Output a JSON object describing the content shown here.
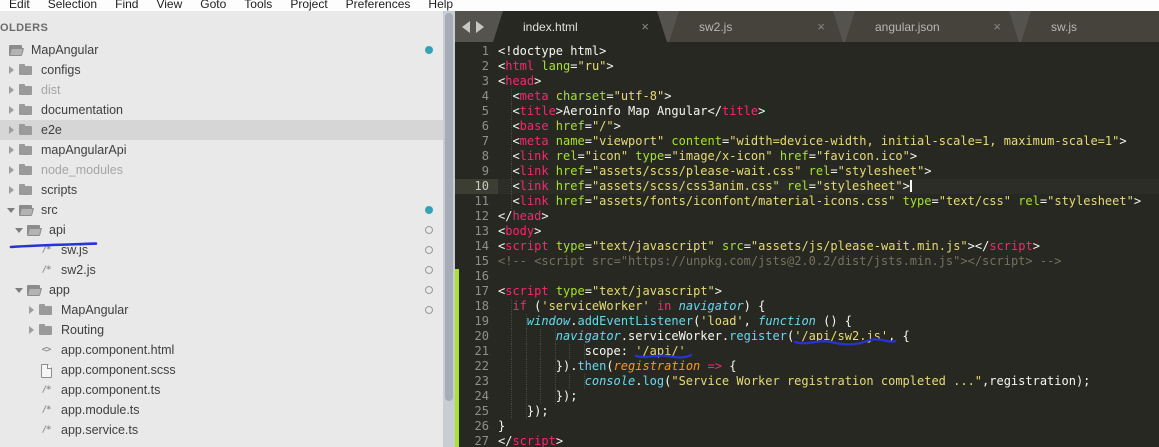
{
  "menu": {
    "items": [
      {
        "label": "Edit",
        "u": 0
      },
      {
        "label": "Selection",
        "u": 0
      },
      {
        "label": "Find",
        "u": 0
      },
      {
        "label": "View",
        "u": 0
      },
      {
        "label": "Goto",
        "u": 0
      },
      {
        "label": "Tools",
        "u": 0
      },
      {
        "label": "Project",
        "u": 0
      },
      {
        "label": "Preferences",
        "u": 7
      },
      {
        "label": "Help",
        "u": 0
      }
    ]
  },
  "sidebar": {
    "header": "OLDERS",
    "tree": [
      {
        "label": "MapAngular",
        "depth": 0,
        "icon": "folder-open",
        "arrow": null,
        "badge": "filled"
      },
      {
        "label": "configs",
        "depth": 1,
        "icon": "folder",
        "arrow": "right"
      },
      {
        "label": "dist",
        "depth": 1,
        "icon": "folder",
        "arrow": "right",
        "dim": true
      },
      {
        "label": "documentation",
        "depth": 1,
        "icon": "folder",
        "arrow": "right"
      },
      {
        "label": "e2e",
        "depth": 1,
        "icon": "folder",
        "arrow": "right",
        "selected": true
      },
      {
        "label": "mapAngularApi",
        "depth": 1,
        "icon": "folder",
        "arrow": "right"
      },
      {
        "label": "node_modules",
        "depth": 1,
        "icon": "folder",
        "arrow": "right",
        "dim": true
      },
      {
        "label": "scripts",
        "depth": 1,
        "icon": "folder",
        "arrow": "right"
      },
      {
        "label": "src",
        "depth": 1,
        "icon": "folder-open",
        "arrow": "down",
        "badge": "filled"
      },
      {
        "label": "api",
        "depth": 2,
        "icon": "folder-open",
        "arrow": "down",
        "badge": "hollow"
      },
      {
        "label": "sw.js",
        "depth": 3,
        "icon": "js",
        "badge": "hollow"
      },
      {
        "label": "sw2.js",
        "depth": 3,
        "icon": "js",
        "badge": "hollow"
      },
      {
        "label": "app",
        "depth": 2,
        "icon": "folder-open",
        "arrow": "down",
        "badge": "hollow"
      },
      {
        "label": "MapAngular",
        "depth": 3,
        "icon": "folder",
        "arrow": "right",
        "badge": "hollow"
      },
      {
        "label": "Routing",
        "depth": 3,
        "icon": "folder",
        "arrow": "right"
      },
      {
        "label": "app.component.html",
        "depth": 3,
        "icon": "html"
      },
      {
        "label": "app.component.scss",
        "depth": 3,
        "icon": "scss"
      },
      {
        "label": "app.component.ts",
        "depth": 3,
        "icon": "js"
      },
      {
        "label": "app.module.ts",
        "depth": 3,
        "icon": "js"
      },
      {
        "label": "app.service.ts",
        "depth": 3,
        "icon": "js"
      }
    ]
  },
  "tabs": {
    "items": [
      {
        "label": "index.html",
        "active": true
      },
      {
        "label": "sw2.js",
        "active": false
      },
      {
        "label": "angular.json",
        "active": false
      },
      {
        "label": "sw.js",
        "active": false
      }
    ]
  },
  "editor": {
    "cursor_line": 10,
    "lines": [
      {
        "n": 1,
        "i": 0,
        "t": [
          [
            "w",
            "<!doctype html>"
          ]
        ]
      },
      {
        "n": 2,
        "i": 0,
        "t": [
          [
            "w",
            "<"
          ],
          [
            "p",
            "html"
          ],
          [
            "g",
            " lang"
          ],
          [
            "w",
            "="
          ],
          [
            "y",
            "\"ru\""
          ],
          [
            "w",
            ">"
          ]
        ]
      },
      {
        "n": 3,
        "i": 0,
        "t": [
          [
            "w",
            "<"
          ],
          [
            "p",
            "head"
          ],
          [
            "w",
            ">"
          ]
        ]
      },
      {
        "n": 4,
        "i": 2,
        "t": [
          [
            "w",
            "<"
          ],
          [
            "p",
            "meta"
          ],
          [
            "g",
            " charset"
          ],
          [
            "w",
            "="
          ],
          [
            "y",
            "\"utf-8\""
          ],
          [
            "w",
            ">"
          ]
        ]
      },
      {
        "n": 5,
        "i": 2,
        "t": [
          [
            "w",
            "<"
          ],
          [
            "p",
            "title"
          ],
          [
            "w",
            ">Aeroinfo Map Angular</"
          ],
          [
            "p",
            "title"
          ],
          [
            "w",
            ">"
          ]
        ]
      },
      {
        "n": 6,
        "i": 2,
        "t": [
          [
            "w",
            "<"
          ],
          [
            "p",
            "base"
          ],
          [
            "g",
            " href"
          ],
          [
            "w",
            "="
          ],
          [
            "y",
            "\"/\""
          ],
          [
            "w",
            ">"
          ]
        ]
      },
      {
        "n": 7,
        "i": 2,
        "t": [
          [
            "w",
            "<"
          ],
          [
            "p",
            "meta"
          ],
          [
            "g",
            " name"
          ],
          [
            "w",
            "="
          ],
          [
            "y",
            "\"viewport\""
          ],
          [
            "g",
            " content"
          ],
          [
            "w",
            "="
          ],
          [
            "y",
            "\"width=device-width, initial-scale=1, maximum-scale=1\""
          ],
          [
            "w",
            ">"
          ]
        ]
      },
      {
        "n": 8,
        "i": 2,
        "t": [
          [
            "w",
            "<"
          ],
          [
            "p",
            "link"
          ],
          [
            "g",
            " rel"
          ],
          [
            "w",
            "="
          ],
          [
            "y",
            "\"icon\""
          ],
          [
            "g",
            " type"
          ],
          [
            "w",
            "="
          ],
          [
            "y",
            "\"image/x-icon\""
          ],
          [
            "g",
            " href"
          ],
          [
            "w",
            "="
          ],
          [
            "y",
            "\"favicon.ico\""
          ],
          [
            "w",
            ">"
          ]
        ]
      },
      {
        "n": 9,
        "i": 2,
        "t": [
          [
            "w",
            "<"
          ],
          [
            "p",
            "link"
          ],
          [
            "g",
            " href"
          ],
          [
            "w",
            "="
          ],
          [
            "y",
            "\"assets/scss/please-wait.css\""
          ],
          [
            "g",
            " rel"
          ],
          [
            "w",
            "="
          ],
          [
            "y",
            "\"stylesheet\""
          ],
          [
            "w",
            ">"
          ]
        ]
      },
      {
        "n": 10,
        "i": 2,
        "t": [
          [
            "w",
            "<"
          ],
          [
            "p",
            "link"
          ],
          [
            "g",
            " href"
          ],
          [
            "w",
            "="
          ],
          [
            "y",
            "\"assets/scss/css3anim.css\""
          ],
          [
            "g",
            " rel"
          ],
          [
            "w",
            "="
          ],
          [
            "y",
            "\"stylesheet\""
          ],
          [
            "w",
            ">"
          ]
        ]
      },
      {
        "n": 11,
        "i": 2,
        "t": [
          [
            "w",
            "<"
          ],
          [
            "p",
            "link"
          ],
          [
            "g",
            " href"
          ],
          [
            "w",
            "="
          ],
          [
            "y",
            "\"assets/fonts/iconfont/material-icons.css\""
          ],
          [
            "g",
            " type"
          ],
          [
            "w",
            "="
          ],
          [
            "y",
            "\"text/css\""
          ],
          [
            "g",
            " rel"
          ],
          [
            "w",
            "="
          ],
          [
            "y",
            "\"stylesheet\""
          ],
          [
            "w",
            ">"
          ]
        ]
      },
      {
        "n": 12,
        "i": 0,
        "t": [
          [
            "w",
            "</"
          ],
          [
            "p",
            "head"
          ],
          [
            "w",
            ">"
          ]
        ]
      },
      {
        "n": 13,
        "i": 0,
        "t": [
          [
            "w",
            "<"
          ],
          [
            "p",
            "body"
          ],
          [
            "w",
            ">"
          ]
        ]
      },
      {
        "n": 14,
        "i": 0,
        "t": [
          [
            "w",
            "<"
          ],
          [
            "p",
            "script"
          ],
          [
            "g",
            " type"
          ],
          [
            "w",
            "="
          ],
          [
            "y",
            "\"text/javascript\""
          ],
          [
            "g",
            " src"
          ],
          [
            "w",
            "="
          ],
          [
            "y",
            "\"assets/js/please-wait.min.js\""
          ],
          [
            "w",
            "></"
          ],
          [
            "p",
            "script"
          ],
          [
            "w",
            ">"
          ]
        ]
      },
      {
        "n": 15,
        "i": 0,
        "t": [
          [
            "cm",
            "<!-- <script src=\"https://unpkg.com/jsts@2.0.2/dist/jsts.min.js\"></script> -->"
          ]
        ]
      },
      {
        "n": 16,
        "i": 0,
        "t": []
      },
      {
        "n": 17,
        "i": 0,
        "t": [
          [
            "w",
            "<"
          ],
          [
            "p",
            "script"
          ],
          [
            "g",
            " type"
          ],
          [
            "w",
            "="
          ],
          [
            "y",
            "\"text/javascript\""
          ],
          [
            "w",
            ">"
          ]
        ]
      },
      {
        "n": 18,
        "i": 2,
        "t": [
          [
            "p",
            "if"
          ],
          [
            "w",
            " ("
          ],
          [
            "y",
            "'serviceWorker'"
          ],
          [
            "w",
            " "
          ],
          [
            "p",
            "in"
          ],
          [
            "w",
            " "
          ],
          [
            "bi",
            "navigator"
          ],
          [
            "w",
            ") {"
          ]
        ]
      },
      {
        "n": 19,
        "i": 4,
        "t": [
          [
            "bi",
            "window"
          ],
          [
            "w",
            "."
          ],
          [
            "b",
            "addEventListener"
          ],
          [
            "w",
            "("
          ],
          [
            "y",
            "'load'"
          ],
          [
            "w",
            ", "
          ],
          [
            "bi",
            "function"
          ],
          [
            "w",
            " () {"
          ]
        ]
      },
      {
        "n": 20,
        "i": 8,
        "t": [
          [
            "bi",
            "navigator"
          ],
          [
            "w",
            ".serviceWorker."
          ],
          [
            "b",
            "register"
          ],
          [
            "w",
            "("
          ],
          [
            "y",
            "'/api/sw2.js'"
          ],
          [
            "w",
            ", {"
          ]
        ]
      },
      {
        "n": 21,
        "i": 12,
        "t": [
          [
            "w",
            "scope: "
          ],
          [
            "y",
            "'/api/'"
          ]
        ]
      },
      {
        "n": 22,
        "i": 8,
        "t": [
          [
            "w",
            "})."
          ],
          [
            "b",
            "then"
          ],
          [
            "w",
            "("
          ],
          [
            "oi",
            "registration"
          ],
          [
            "w",
            " "
          ],
          [
            "p",
            "=>"
          ],
          [
            "w",
            " {"
          ]
        ]
      },
      {
        "n": 23,
        "i": 12,
        "t": [
          [
            "bi",
            "console"
          ],
          [
            "w",
            "."
          ],
          [
            "b",
            "log"
          ],
          [
            "w",
            "("
          ],
          [
            "y",
            "\"Service Worker registration completed ...\""
          ],
          [
            "w",
            ",registration);"
          ]
        ]
      },
      {
        "n": 24,
        "i": 8,
        "t": [
          [
            "w",
            "});"
          ]
        ]
      },
      {
        "n": 25,
        "i": 4,
        "t": [
          [
            "w",
            "});"
          ]
        ]
      },
      {
        "n": 26,
        "i": 0,
        "t": [
          [
            "w",
            "}"
          ]
        ]
      },
      {
        "n": 27,
        "i": 0,
        "t": [
          [
            "w",
            "</"
          ],
          [
            "p",
            "script"
          ],
          [
            "w",
            ">"
          ]
        ]
      }
    ]
  },
  "annotations": {
    "pen_color": "#2733d4",
    "items": [
      {
        "target": "sidebar api folder row",
        "shape": "straight-underline"
      },
      {
        "target": "line 20 string '/api/sw2.js'",
        "shape": "wavy-underline"
      },
      {
        "target": "line 21 string '/api/'",
        "shape": "wavy-underline"
      }
    ]
  },
  "colors": {
    "editor_bg": "#272822",
    "tag_pink": "#f92672",
    "attr_green": "#a6e22e",
    "string_yellow": "#e6db74",
    "comment_gray": "#75715e",
    "func_blue": "#66d9ef",
    "param_orange": "#fd971f",
    "text_white": "#f8f8f2",
    "git_added_bar": "#a6e22e",
    "status_dot_teal": "#35a3b5",
    "tabbar_bg": "#55534d",
    "sidebar_bg": "#e9e9e9"
  }
}
